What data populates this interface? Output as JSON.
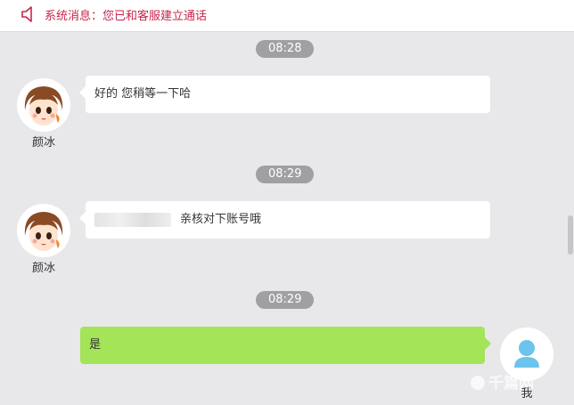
{
  "system_bar": {
    "message": "系统消息：您已和客服建立通话",
    "icon": "speaker-icon",
    "color": "#c7254e"
  },
  "messages": [
    {
      "time": "08:28",
      "sender": "颜冰",
      "text": "好的 您稍等一下哈",
      "side": "left"
    },
    {
      "time": "08:29",
      "sender": "颜冰",
      "text": "亲核对下账号哦",
      "side": "left",
      "partially_obscured": true
    },
    {
      "time": "08:29",
      "sender": "我",
      "text": "是",
      "side": "right"
    }
  ],
  "colors": {
    "background": "#e8e8eb",
    "agent_bubble": "#ffffff",
    "user_bubble": "#a3e459",
    "time_pill": "#a0a0a3",
    "user_avatar": "#6cc3ec"
  },
  "watermark": "千篇网"
}
